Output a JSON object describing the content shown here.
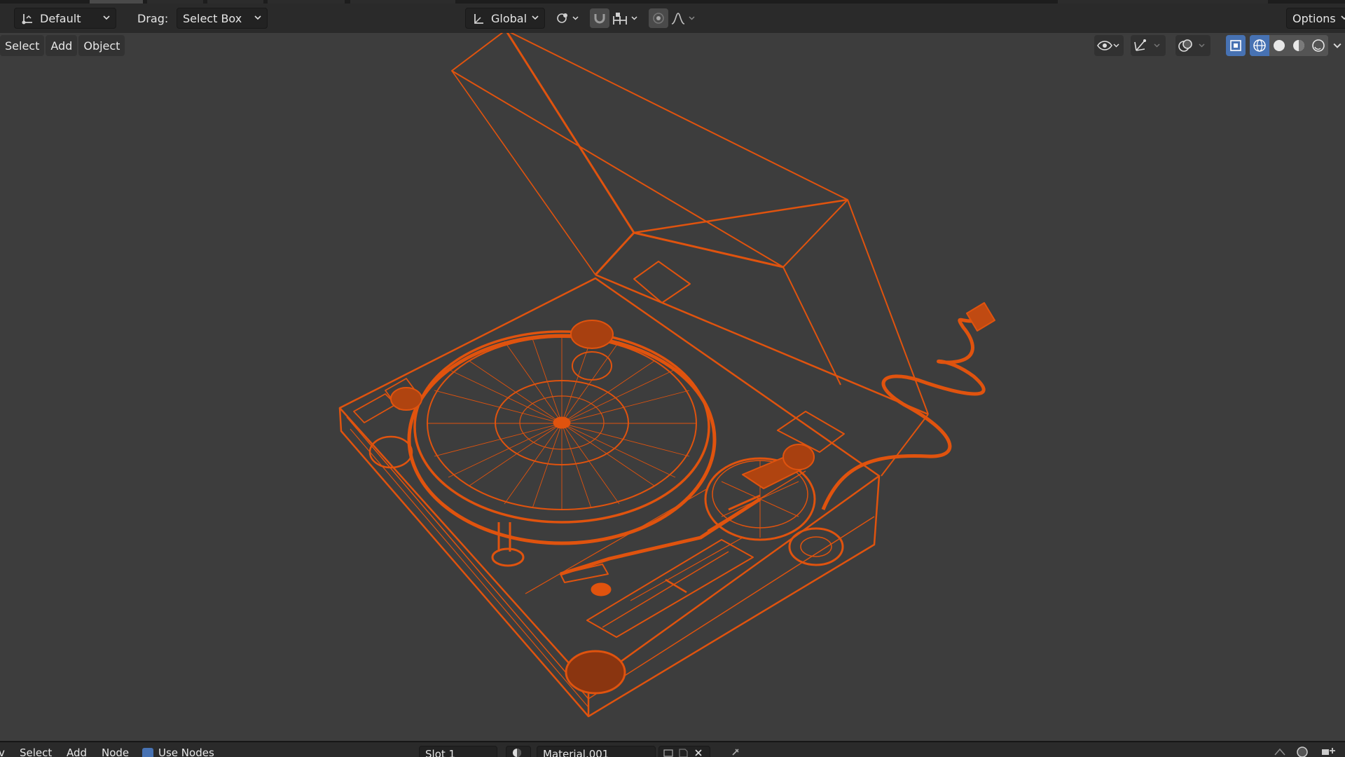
{
  "header": {
    "pivot_preset": "Default",
    "drag_label": "Drag:",
    "drag_value": "Select Box",
    "orientation": "Global",
    "options_label": "Options"
  },
  "viewport_menu": {
    "items": [
      "Select",
      "Add",
      "Object"
    ]
  },
  "viewport": {
    "shading_mode": "wireframe",
    "selection_color": "#e0530e",
    "background_color": "#3d3d3d"
  },
  "footer": {
    "menu": [
      "Select",
      "Add",
      "Node"
    ],
    "use_nodes_label": "Use Nodes",
    "slot": "Slot 1",
    "material": "Material.001"
  },
  "colors": {
    "header_bg": "#2a2a2a",
    "accent": "#4772b3",
    "wire": "#e0530e"
  }
}
